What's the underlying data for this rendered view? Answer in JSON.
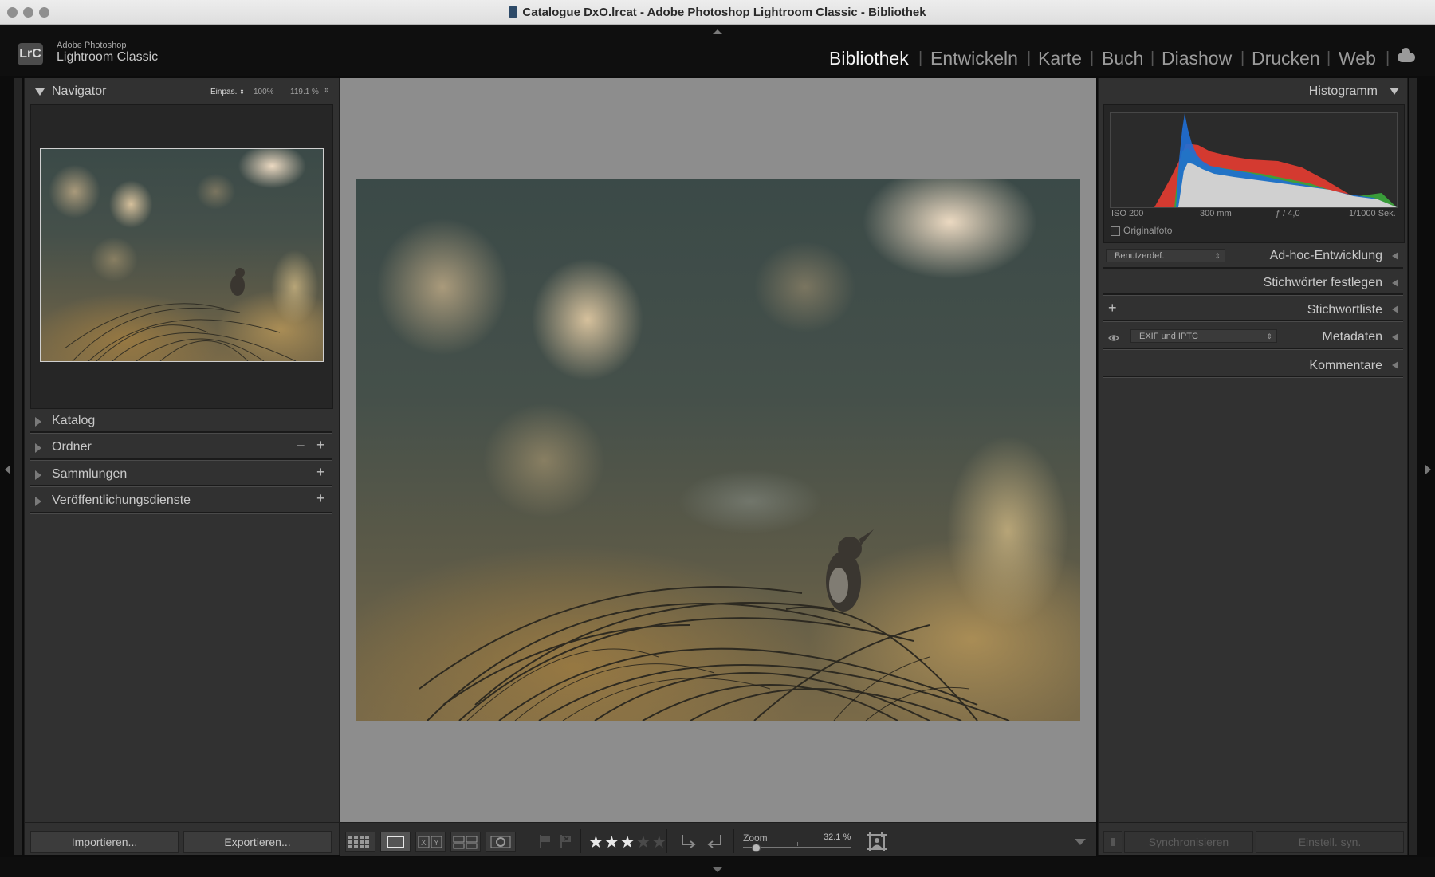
{
  "window": {
    "title": "Catalogue DxO.lrcat - Adobe Photoshop Lightroom Classic - Bibliothek"
  },
  "brand": {
    "logo": "LrC",
    "line1": "Adobe Photoshop",
    "line2": "Lightroom Classic"
  },
  "modules": [
    "Bibliothek",
    "Entwickeln",
    "Karte",
    "Buch",
    "Diashow",
    "Drucken",
    "Web"
  ],
  "active_module": "Bibliothek",
  "left": {
    "navigator": {
      "title": "Navigator",
      "fit": "Einpas.",
      "zoom1": "100%",
      "zoom2": "119.1 %"
    },
    "panels": [
      "Katalog",
      "Ordner",
      "Sammlungen",
      "Veröffentlichungsdienste"
    ],
    "import_label": "Importieren...",
    "export_label": "Exportieren..."
  },
  "right": {
    "histogram": {
      "title": "Histogramm",
      "iso": "ISO 200",
      "focal": "300 mm",
      "aperture": "ƒ / 4,0",
      "shutter": "1/1000 Sek.",
      "original": "Originalfoto"
    },
    "quick_develop": {
      "preset": "Benutzerdef.",
      "title": "Ad-hoc-Entwicklung"
    },
    "keywording": "Stichwörter festlegen",
    "keyword_list": "Stichwortliste",
    "metadata": {
      "preset": "EXIF und IPTC",
      "title": "Metadaten"
    },
    "comments": "Kommentare",
    "sync_label": "Synchronisieren",
    "sync_settings_label": "Einstell. syn."
  },
  "toolbar": {
    "zoom_label": "Zoom",
    "zoom_value": "32.1 %",
    "rating": 3,
    "rating_max": 5,
    "zoom_level": 0.12
  },
  "colors": {
    "accent_text": "#f2f2f2",
    "panel_bg": "#313131",
    "center_bg": "#8d8d8d"
  },
  "icons": [
    "grid-view-icon",
    "loupe-view-icon",
    "compare-view-icon",
    "survey-view-icon",
    "people-view-icon",
    "flag-icon",
    "reject-flag-icon",
    "star-icon",
    "rotate-left-icon",
    "rotate-right-icon",
    "crop-overlay-icon",
    "cloud-icon",
    "eye-icon"
  ]
}
